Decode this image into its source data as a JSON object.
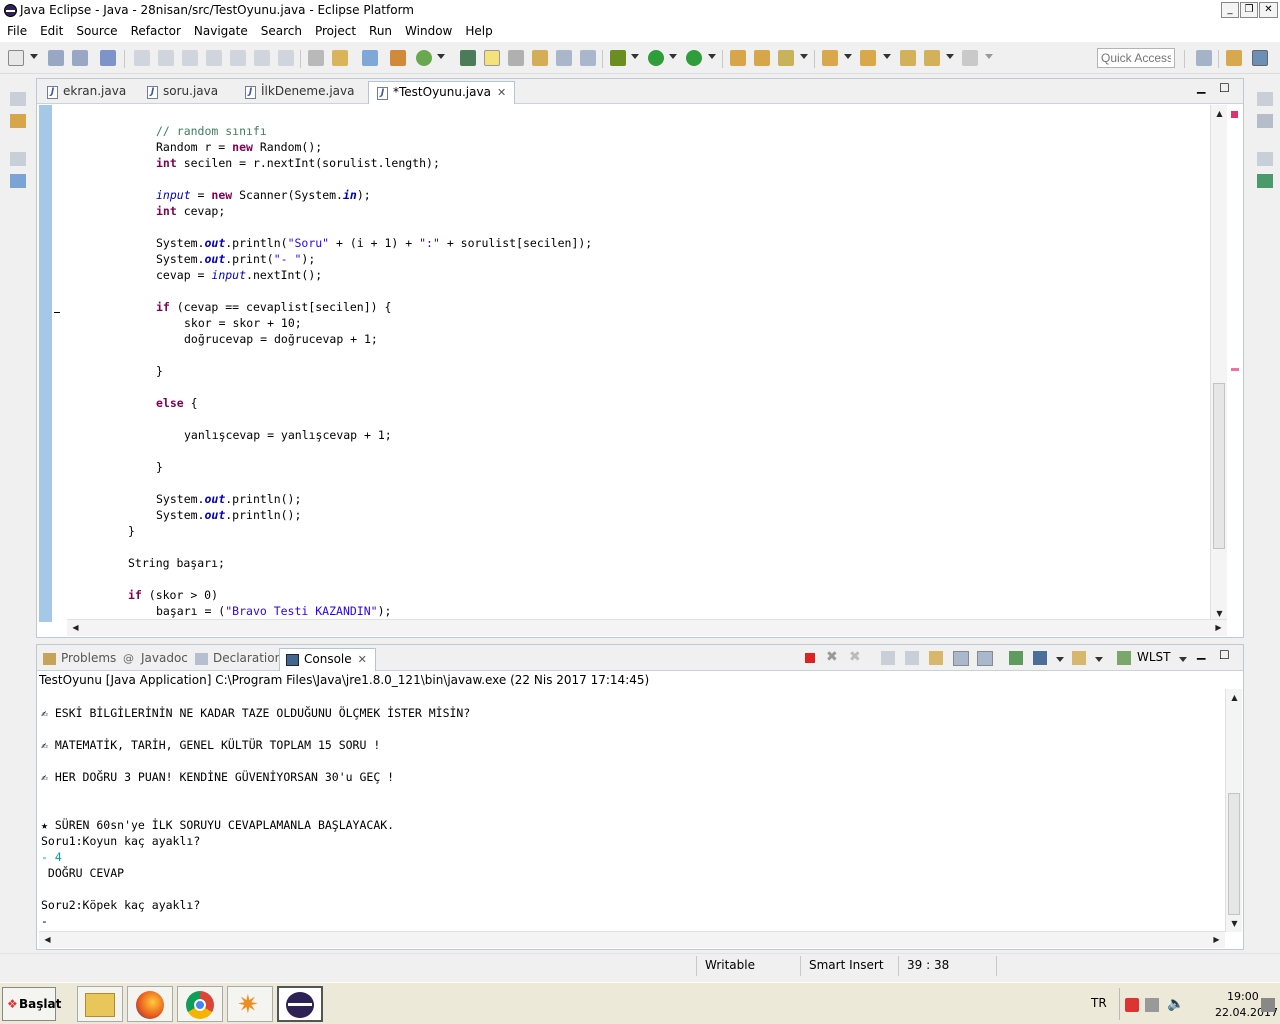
{
  "window": {
    "title": "Java Eclipse - Java - 28nisan/src/TestOyunu.java - Eclipse Platform"
  },
  "menu": [
    "File",
    "Edit",
    "Source",
    "Refactor",
    "Navigate",
    "Search",
    "Project",
    "Run",
    "Window",
    "Help"
  ],
  "toolbar": {
    "quick_access_placeholder": "Quick Access"
  },
  "editor": {
    "tabs": [
      {
        "label": "ekran.java",
        "active": false
      },
      {
        "label": "soru.java",
        "active": false
      },
      {
        "label": "İlkDeneme.java",
        "active": false
      },
      {
        "label": "*TestOyunu.java",
        "active": true
      }
    ],
    "close_glyph": "✕"
  },
  "console": {
    "tabs": [
      {
        "label": "Problems",
        "active": false
      },
      {
        "label": "Javadoc",
        "active": false
      },
      {
        "label": "Declaration",
        "active": false
      },
      {
        "label": "Console",
        "active": true
      }
    ],
    "wlst_label": "WLST",
    "description": "TestOyunu [Java Application] C:\\Program Files\\Java\\jre1.8.0_121\\bin\\javaw.exe (22 Nis 2017 17:14:45)",
    "output": [
      "✍ ESKİ BİLGİLERİNİN NE KADAR TAZE OLDUĞUNU ÖLÇMEK İSTER MİSİN?",
      "",
      "✍ MATEMATİK, TARİH, GENEL KÜLTÜR TOPLAM 15 SORU !",
      "",
      "✍ HER DOĞRU 3 PUAN! KENDİNE GÜVENİYORSAN 30'u GEÇ !",
      "",
      "",
      "★ SÜREN 60sn'ye İLK SORUYU CEVAPLAMANLA BAŞLAYACAK.",
      "Soru1:Koyun kaç ayaklı?",
      "- 4",
      " DOĞRU CEVAP",
      "",
      "Soru2:Köpek kaç ayaklı?",
      "-"
    ]
  },
  "statusbar": {
    "mode": "Writable",
    "insert": "Smart Insert",
    "position": "39 : 38"
  },
  "taskbar": {
    "start_label": "Başlat",
    "lang": "TR",
    "time": "19:00",
    "date": "22.04.2017"
  }
}
